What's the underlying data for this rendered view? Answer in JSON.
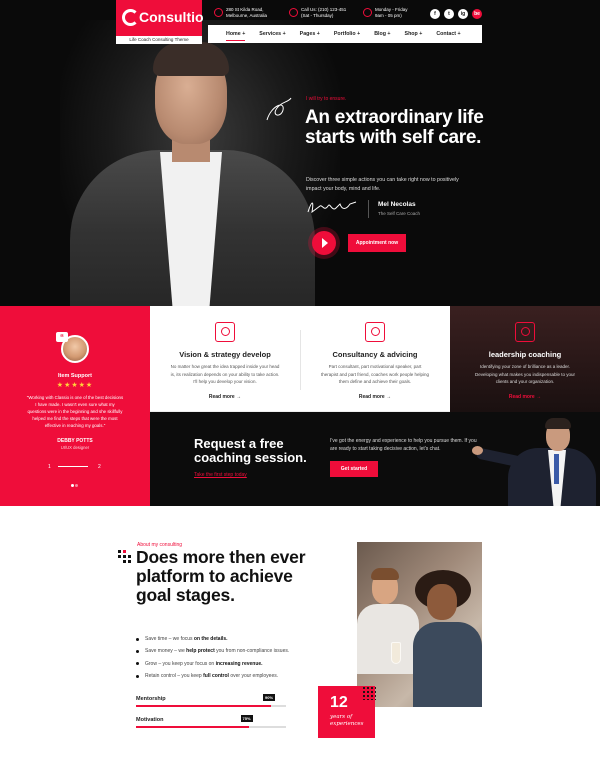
{
  "brand": {
    "logo_text": "Consultio",
    "tagline": "Life Coach Consulting Theme",
    "accent": "#ef0d3a"
  },
  "topbar": {
    "address": [
      "280 St Kilda Road,",
      "Melbourne, Australia"
    ],
    "phone": [
      "Call Us: (210) 123-451",
      "(Sat - Thursday)"
    ],
    "hours": [
      "Monday - Friday",
      "9am - 05 pm)"
    ],
    "social": [
      "f",
      "t",
      "ig",
      "be"
    ]
  },
  "nav": [
    "Home +",
    "Services +",
    "Pages +",
    "Portfolio +",
    "Blog +",
    "Shop +",
    "Contact +"
  ],
  "hero": {
    "eyebrow": "I will try to ensure.",
    "headline": "An extraordinary life starts with self care.",
    "description": "Discover three simple actions you can take right now to positively impact your body, mind and life.",
    "signature": "Lrs Saft",
    "name": "Mel Necolas",
    "role": "The Self Care Coach",
    "button": "Appointment now"
  },
  "testimonial": {
    "label": "Item Support",
    "stars": "★★★★★",
    "quote": "\"Working with Classio is one of the best decisions I have made. I wasn't even sure what my questions were in the beginning and she skillfully helped me find the steps that were the most effective in reaching my goals.\"",
    "name": "DEBBY POTTS",
    "role": "UI/UX designer",
    "pager_start": "1",
    "pager_end": "2"
  },
  "features": [
    {
      "title": "Vision & strategy develop",
      "description": "No matter how great the idea trapped inside your head is, its realization depends on your ability to take action. I'll help you develop your vision.",
      "more": "Read more →"
    },
    {
      "title": "Consultancy & advicing",
      "description": "Part consultant, part motivational speaker, part therapist and part friend, coaches work people helping them define and achieve their goals.",
      "more": "Read more →"
    },
    {
      "title": "leadership coaching",
      "description": "Identifying your zone of brilliance as a leader. Developing what makes you indispensable to your clients and your organization.",
      "more": "Read more →"
    }
  ],
  "cta": {
    "title": "Request a free coaching session.",
    "link": "Take the first step today",
    "text": "I've got the energy and experience to help you pursue them. If you are ready to start taking decisive action, let's chat.",
    "button": "Get started"
  },
  "about": {
    "eyebrow": "About my consulting",
    "title": "Does more then ever platform to achieve goal stages.",
    "bullets": [
      [
        "Save time – we focus ",
        "on the details."
      ],
      [
        "Save money – we ",
        "help protect",
        " you from non-compliance issues."
      ],
      [
        "Grow – you keep your focus on ",
        "increasing revenue."
      ],
      [
        "Retain control – you keep ",
        "full control",
        " over your employees."
      ]
    ],
    "bars": [
      {
        "label": "Mentorship",
        "value": 90,
        "value_label": "90%"
      },
      {
        "label": "Motivation",
        "value": 75,
        "value_label": "75%"
      }
    ],
    "experience_number": "12",
    "experience_text": "years of experiences"
  }
}
